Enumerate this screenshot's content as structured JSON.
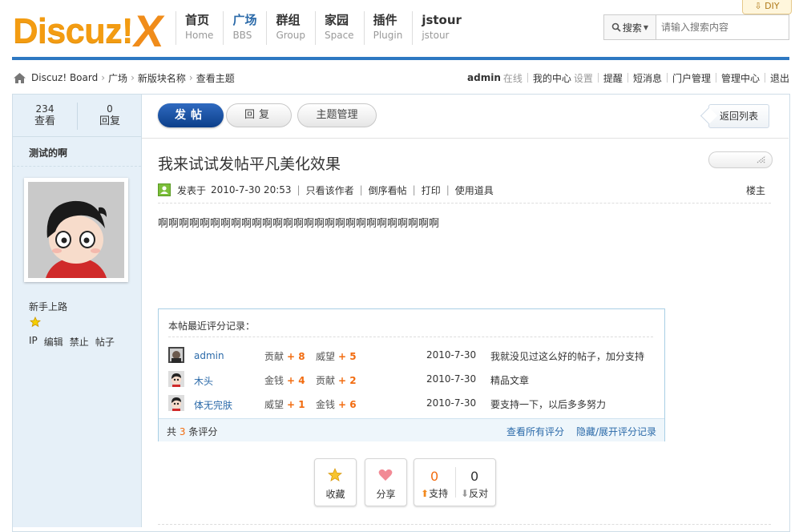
{
  "header": {
    "logo_text": "Discuz!",
    "logo_mark": "X",
    "diy_label": "DIY",
    "nav": [
      {
        "zh": "首页",
        "en": "Home"
      },
      {
        "zh": "广场",
        "en": "BBS"
      },
      {
        "zh": "群组",
        "en": "Group"
      },
      {
        "zh": "家园",
        "en": "Space"
      },
      {
        "zh": "插件",
        "en": "Plugin"
      },
      {
        "zh": "jstour",
        "en": "jstour"
      }
    ],
    "search": {
      "type_label": "搜索",
      "placeholder": "请输入搜索内容"
    }
  },
  "breadcrumb": [
    "Discuz! Board",
    "广场",
    "新版块名称",
    "查看主题"
  ],
  "usernav": {
    "username": "admin",
    "status": "在线",
    "my_center": "我的中心",
    "settings": "设置",
    "items": [
      "提醒",
      "短消息",
      "门户管理",
      "管理中心",
      "退出"
    ]
  },
  "sidebar": {
    "views_num": "234",
    "views_label": "查看",
    "replies_num": "0",
    "replies_label": "回复",
    "author": "测试的啊",
    "rank": "新手上路",
    "ops": [
      "IP",
      "编辑",
      "禁止",
      "帖子"
    ]
  },
  "toolbar": {
    "post_label": "发帖",
    "reply_label": "回复",
    "manage_label": "主题管理",
    "back_label": "返回列表"
  },
  "thread": {
    "title": "我来试试发帖平凡美化效果",
    "posted_prefix": "发表于",
    "posted_time": "2010-7-30 20:53",
    "links": [
      "只看该作者",
      "倒序看帖",
      "打印",
      "使用道具"
    ],
    "floor": "楼主",
    "content": "啊啊啊啊啊啊啊啊啊啊啊啊啊啊啊啊啊啊啊啊啊啊啊啊啊啊啊"
  },
  "ratings": {
    "header": "本帖最近评分记录：",
    "rows": [
      {
        "user": "admin",
        "s1_label": "贡献",
        "s1_val": "+ 8",
        "s2_label": "威望",
        "s2_val": "+ 5",
        "date": "2010-7-30",
        "reason": "我就没见过这么好的帖子，加分支持"
      },
      {
        "user": "木头",
        "s1_label": "金钱",
        "s1_val": "+ 4",
        "s2_label": "贡献",
        "s2_val": "+ 2",
        "date": "2010-7-30",
        "reason": "精品文章"
      },
      {
        "user": "体无完肤",
        "s1_label": "威望",
        "s1_val": "+ 1",
        "s2_label": "金钱",
        "s2_val": "+ 6",
        "date": "2010-7-30",
        "reason": "要支持一下，以后多多努力"
      }
    ],
    "total_prefix": "共",
    "total_count": "3",
    "total_suffix": "条评分",
    "view_all": "查看所有评分",
    "toggle": "隐藏/展开评分记录"
  },
  "actions": {
    "favorite": "收藏",
    "share": "分享",
    "support_count": "0",
    "oppose_count": "0",
    "support_label": "支持",
    "oppose_label": "反对"
  },
  "colors": {
    "accent_blue": "#2e78c2",
    "orange": "#f26c10",
    "logo_orange": "#f39c12"
  }
}
